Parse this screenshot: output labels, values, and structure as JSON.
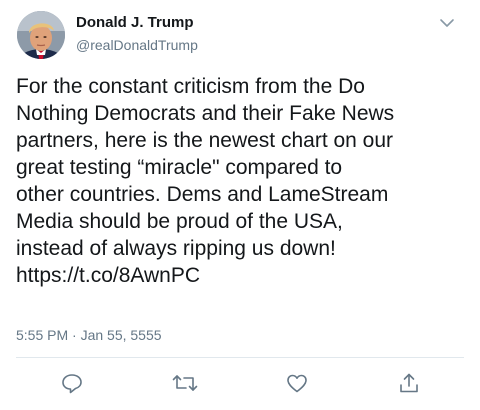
{
  "author": {
    "name": "Donald J. Trump",
    "handle": "@realDonaldTrump"
  },
  "tweet": {
    "lines": [
      "For the constant criticism from the Do",
      "Nothing Democrats and their Fake News",
      "partners, here is the newest chart on our",
      "great testing “miracle\" compared to",
      "other countries. Dems and LameStream",
      "Media should be proud of the USA,",
      "instead of always ripping us down!",
      "https://t.co/8AwnPC"
    ],
    "timestamp": "5:55 PM · Jan 55, 5555"
  },
  "icons": {
    "menu": "chevron-down-icon",
    "reply": "reply-icon",
    "retweet": "retweet-icon",
    "like": "heart-icon",
    "share": "share-icon"
  },
  "colors": {
    "text": "#14171a",
    "secondary": "#657786",
    "divider": "#e1e8ed"
  }
}
